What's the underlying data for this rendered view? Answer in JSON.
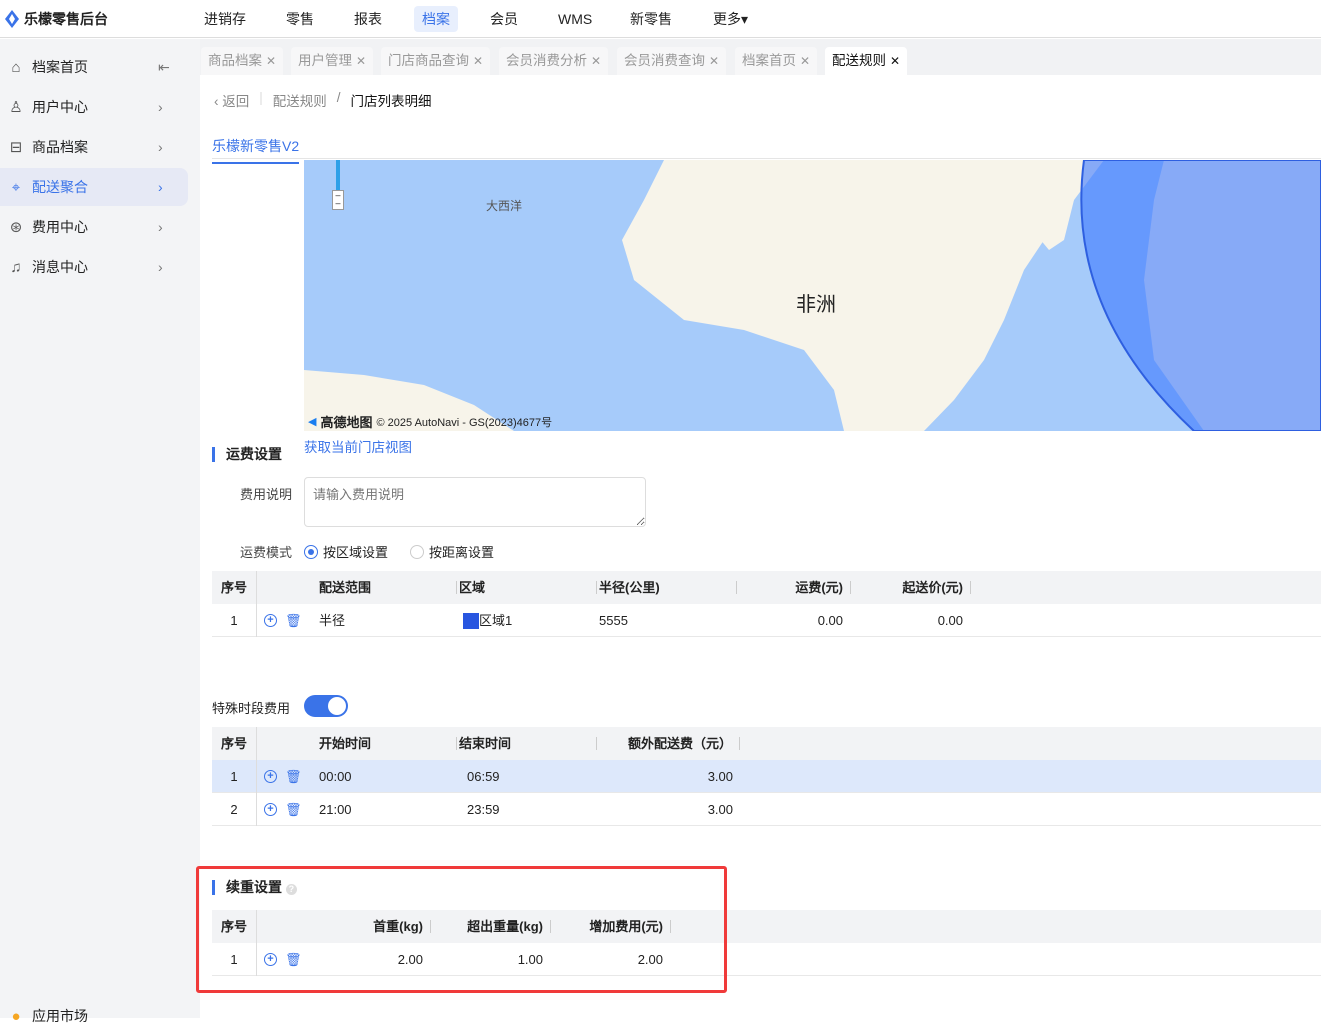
{
  "app": {
    "title": "乐檬零售后台"
  },
  "topnav": [
    {
      "label": "进销存"
    },
    {
      "label": "零售"
    },
    {
      "label": "报表"
    },
    {
      "label": "档案",
      "active": true
    },
    {
      "label": "会员"
    },
    {
      "label": "WMS"
    },
    {
      "label": "新零售"
    },
    {
      "label": "更多▾"
    }
  ],
  "sidebar": {
    "items": [
      {
        "label": "档案首页",
        "icon": "home-icon"
      },
      {
        "label": "用户中心",
        "icon": "user-icon"
      },
      {
        "label": "商品档案",
        "icon": "box-icon"
      },
      {
        "label": "配送聚合",
        "icon": "map-icon",
        "active": true
      },
      {
        "label": "费用中心",
        "icon": "yen-icon"
      },
      {
        "label": "消息中心",
        "icon": "bell-icon"
      }
    ],
    "bottom": "应用市场"
  },
  "tabs": [
    {
      "label": "商品档案"
    },
    {
      "label": "用户管理"
    },
    {
      "label": "门店商品查询"
    },
    {
      "label": "会员消费分析"
    },
    {
      "label": "会员消费查询"
    },
    {
      "label": "档案首页"
    },
    {
      "label": "配送规则",
      "active": true
    }
  ],
  "breadcrumb": {
    "back": "返回",
    "parent": "配送规则",
    "current": "门店列表明细"
  },
  "map": {
    "tab": "乐檬新零售V2",
    "ocean_label": "大西洋",
    "continent_label": "非洲",
    "attribution": "© 2025 AutoNavi - GS(2023)4677号",
    "logo": "高德地图",
    "get_view_link": "获取当前门店视图"
  },
  "fee": {
    "title": "运费设置",
    "desc_label": "费用说明",
    "desc_placeholder": "请输入费用说明",
    "mode_label": "运费模式",
    "modes": [
      {
        "label": "按区域设置",
        "selected": true
      },
      {
        "label": "按距离设置",
        "selected": false
      }
    ],
    "columns": [
      "序号",
      "配送范围",
      "区域",
      "半径(公里)",
      "运费(元)",
      "起送价(元)"
    ],
    "rows": [
      {
        "idx": "1",
        "range": "半径",
        "area": "区域1",
        "area_color": "#2856e0",
        "radius": "5555",
        "fee": "0.00",
        "min": "0.00"
      }
    ]
  },
  "special": {
    "label": "特殊时段费用",
    "enabled": true,
    "columns": [
      "序号",
      "开始时间",
      "结束时间",
      "额外配送费（元）"
    ],
    "rows": [
      {
        "idx": "1",
        "start": "00:00",
        "end": "06:59",
        "extra": "3.00"
      },
      {
        "idx": "2",
        "start": "21:00",
        "end": "23:59",
        "extra": "3.00"
      }
    ]
  },
  "weight": {
    "title": "续重设置",
    "columns": [
      "序号",
      "首重(kg)",
      "超出重量(kg)",
      "增加费用(元)"
    ],
    "rows": [
      {
        "idx": "1",
        "first": "2.00",
        "over": "1.00",
        "add": "2.00"
      }
    ]
  },
  "colors": {
    "accent": "#3a73e8",
    "highlight_box": "#f03a3a"
  }
}
